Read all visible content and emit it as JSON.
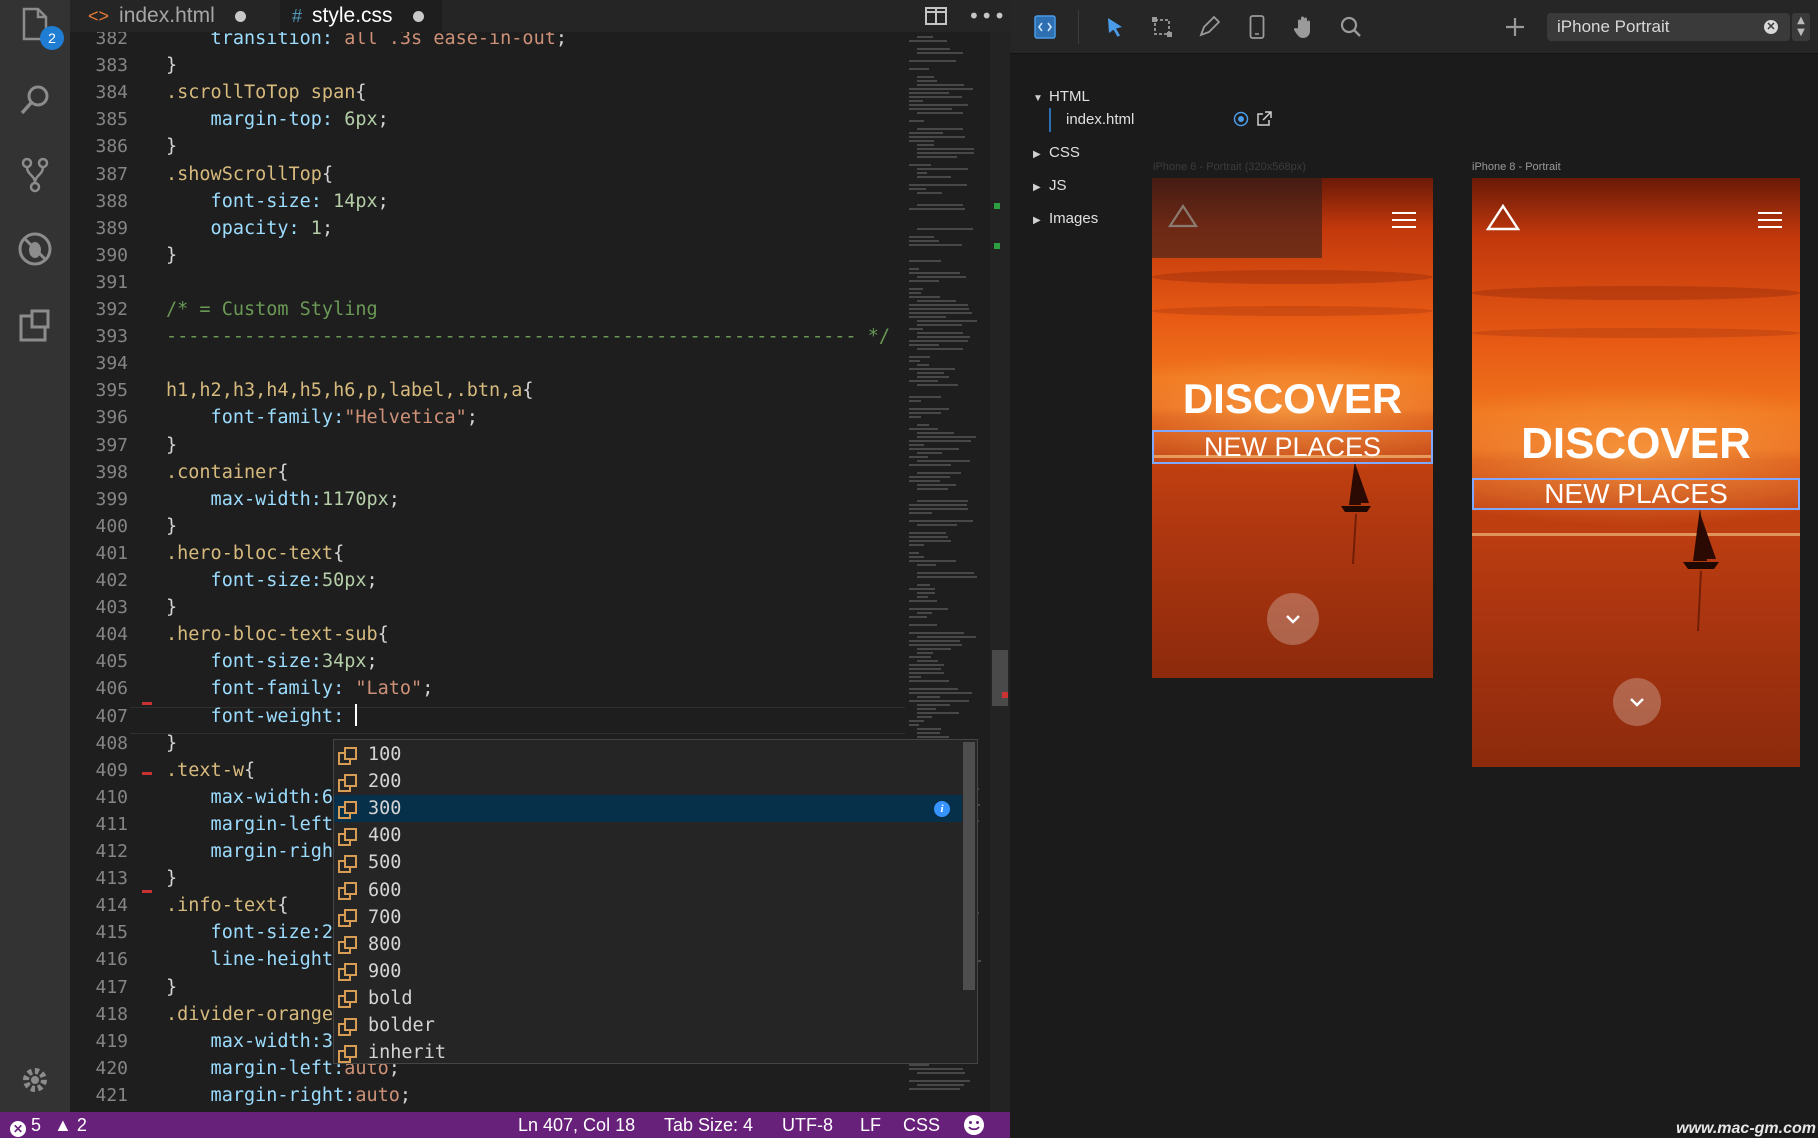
{
  "editor": {
    "tabs": [
      {
        "icon": "<>",
        "label": "index.html",
        "modified": true,
        "active": false
      },
      {
        "icon": "#",
        "label": "style.css",
        "modified": true,
        "active": true
      }
    ],
    "activity_badge": "2",
    "code_lines": [
      {
        "n": "382",
        "tokens": [
          [
            "c-prop",
            "    transition: "
          ],
          [
            "c-str",
            "all .3s ease-in-out"
          ],
          [
            "c-punc",
            ";"
          ]
        ]
      },
      {
        "n": "383",
        "tokens": [
          [
            "c-punc",
            "}"
          ]
        ]
      },
      {
        "n": "384",
        "tokens": [
          [
            "c-sel",
            ".scrollToTop span"
          ],
          [
            "c-punc",
            "{"
          ]
        ]
      },
      {
        "n": "385",
        "tokens": [
          [
            "c-prop",
            "    margin-top: "
          ],
          [
            "c-num",
            "6px"
          ],
          [
            "c-punc",
            ";"
          ]
        ]
      },
      {
        "n": "386",
        "tokens": [
          [
            "c-punc",
            "}"
          ]
        ]
      },
      {
        "n": "387",
        "tokens": [
          [
            "c-sel",
            ".showScrollTop"
          ],
          [
            "c-punc",
            "{"
          ]
        ]
      },
      {
        "n": "388",
        "tokens": [
          [
            "c-prop",
            "    font-size: "
          ],
          [
            "c-num",
            "14px"
          ],
          [
            "c-punc",
            ";"
          ]
        ]
      },
      {
        "n": "389",
        "tokens": [
          [
            "c-prop",
            "    opacity: "
          ],
          [
            "c-num",
            "1"
          ],
          [
            "c-punc",
            ";"
          ]
        ]
      },
      {
        "n": "390",
        "tokens": [
          [
            "c-punc",
            "}"
          ]
        ]
      },
      {
        "n": "391",
        "tokens": []
      },
      {
        "n": "392",
        "tokens": [
          [
            "c-cmt",
            "/* = Custom Styling"
          ]
        ]
      },
      {
        "n": "393",
        "tokens": [
          [
            "c-cmt",
            "-------------------------------------------------------------- */"
          ]
        ]
      },
      {
        "n": "394",
        "tokens": []
      },
      {
        "n": "395",
        "tokens": [
          [
            "c-sel",
            "h1,h2,h3,h4,h5,h6,p,label,.btn,a"
          ],
          [
            "c-punc",
            "{"
          ]
        ]
      },
      {
        "n": "396",
        "tokens": [
          [
            "c-prop",
            "    font-family:"
          ],
          [
            "c-str",
            "\"Helvetica\""
          ],
          [
            "c-punc",
            ";"
          ]
        ]
      },
      {
        "n": "397",
        "tokens": [
          [
            "c-punc",
            "}"
          ]
        ]
      },
      {
        "n": "398",
        "tokens": [
          [
            "c-sel",
            ".container"
          ],
          [
            "c-punc",
            "{"
          ]
        ]
      },
      {
        "n": "399",
        "tokens": [
          [
            "c-prop",
            "    max-width:"
          ],
          [
            "c-num",
            "1170px"
          ],
          [
            "c-punc",
            ";"
          ]
        ]
      },
      {
        "n": "400",
        "tokens": [
          [
            "c-punc",
            "}"
          ]
        ]
      },
      {
        "n": "401",
        "tokens": [
          [
            "c-sel",
            ".hero-bloc-text"
          ],
          [
            "c-punc",
            "{"
          ]
        ]
      },
      {
        "n": "402",
        "tokens": [
          [
            "c-prop",
            "    font-size:"
          ],
          [
            "c-num",
            "50px"
          ],
          [
            "c-punc",
            ";"
          ]
        ]
      },
      {
        "n": "403",
        "tokens": [
          [
            "c-punc",
            "}"
          ]
        ]
      },
      {
        "n": "404",
        "tokens": [
          [
            "c-sel",
            ".hero-bloc-text-sub"
          ],
          [
            "c-punc",
            "{"
          ]
        ]
      },
      {
        "n": "405",
        "tokens": [
          [
            "c-prop",
            "    font-size:"
          ],
          [
            "c-num",
            "34px"
          ],
          [
            "c-punc",
            ";"
          ]
        ]
      },
      {
        "n": "406",
        "tokens": [
          [
            "c-prop",
            "    font-family: "
          ],
          [
            "c-str",
            "\"Lato\""
          ],
          [
            "c-punc",
            ";"
          ]
        ]
      },
      {
        "n": "407",
        "tokens": [
          [
            "c-prop",
            "    font-weight: "
          ]
        ],
        "cursor": true
      },
      {
        "n": "408",
        "tokens": [
          [
            "c-punc",
            "}"
          ]
        ]
      },
      {
        "n": "409",
        "tokens": [
          [
            "c-sel",
            ".text-w"
          ],
          [
            "c-punc",
            "{"
          ]
        ]
      },
      {
        "n": "410",
        "tokens": [
          [
            "c-prop",
            "    max-width:6"
          ]
        ]
      },
      {
        "n": "411",
        "tokens": [
          [
            "c-prop",
            "    margin-left"
          ]
        ]
      },
      {
        "n": "412",
        "tokens": [
          [
            "c-prop",
            "    margin-righ"
          ]
        ]
      },
      {
        "n": "413",
        "tokens": [
          [
            "c-punc",
            "}"
          ]
        ]
      },
      {
        "n": "414",
        "tokens": [
          [
            "c-sel",
            ".info-text"
          ],
          [
            "c-punc",
            "{"
          ]
        ]
      },
      {
        "n": "415",
        "tokens": [
          [
            "c-prop",
            "    font-size:2"
          ]
        ]
      },
      {
        "n": "416",
        "tokens": [
          [
            "c-prop",
            "    line-height"
          ]
        ]
      },
      {
        "n": "417",
        "tokens": [
          [
            "c-punc",
            "}"
          ]
        ]
      },
      {
        "n": "418",
        "tokens": [
          [
            "c-sel",
            ".divider-orange"
          ]
        ]
      },
      {
        "n": "419",
        "tokens": [
          [
            "c-prop",
            "    max-width:3"
          ]
        ]
      },
      {
        "n": "420",
        "tokens": [
          [
            "c-prop",
            "    margin-left:"
          ],
          [
            "c-str",
            "auto"
          ],
          [
            "c-punc",
            ";"
          ]
        ]
      },
      {
        "n": "421",
        "tokens": [
          [
            "c-prop",
            "    margin-right:"
          ],
          [
            "c-str",
            "auto"
          ],
          [
            "c-punc",
            ";"
          ]
        ]
      }
    ],
    "suggestions": [
      "100",
      "200",
      "300",
      "400",
      "500",
      "600",
      "700",
      "800",
      "900",
      "bold",
      "bolder",
      "inherit"
    ],
    "selected_suggestion": "300",
    "status": {
      "errors": "5",
      "warnings": "2",
      "position": "Ln 407, Col 18",
      "tab_size": "Tab Size: 4",
      "encoding": "UTF-8",
      "eol": "LF",
      "language": "CSS"
    }
  },
  "preview": {
    "device_select": "iPhone Portrait",
    "tree": [
      {
        "label": "HTML",
        "expanded": true
      },
      {
        "label": "index.html",
        "child": true
      },
      {
        "label": "CSS",
        "expanded": false
      },
      {
        "label": "JS",
        "expanded": false
      },
      {
        "label": "Images",
        "expanded": false
      }
    ],
    "devices": [
      {
        "label": "iPhone 6 - Portrait (320x568px)",
        "title": "DISCOVER",
        "subtitle": "NEW PLACES"
      },
      {
        "label": "iPhone 8 - Portrait",
        "title": "DISCOVER",
        "subtitle": "NEW PLACES"
      }
    ]
  },
  "watermark": "www.mac-gm.com",
  "colors": {
    "status_bar": "#68217a",
    "accent": "#1f7dd4",
    "hero_orange": "#e75a14"
  }
}
